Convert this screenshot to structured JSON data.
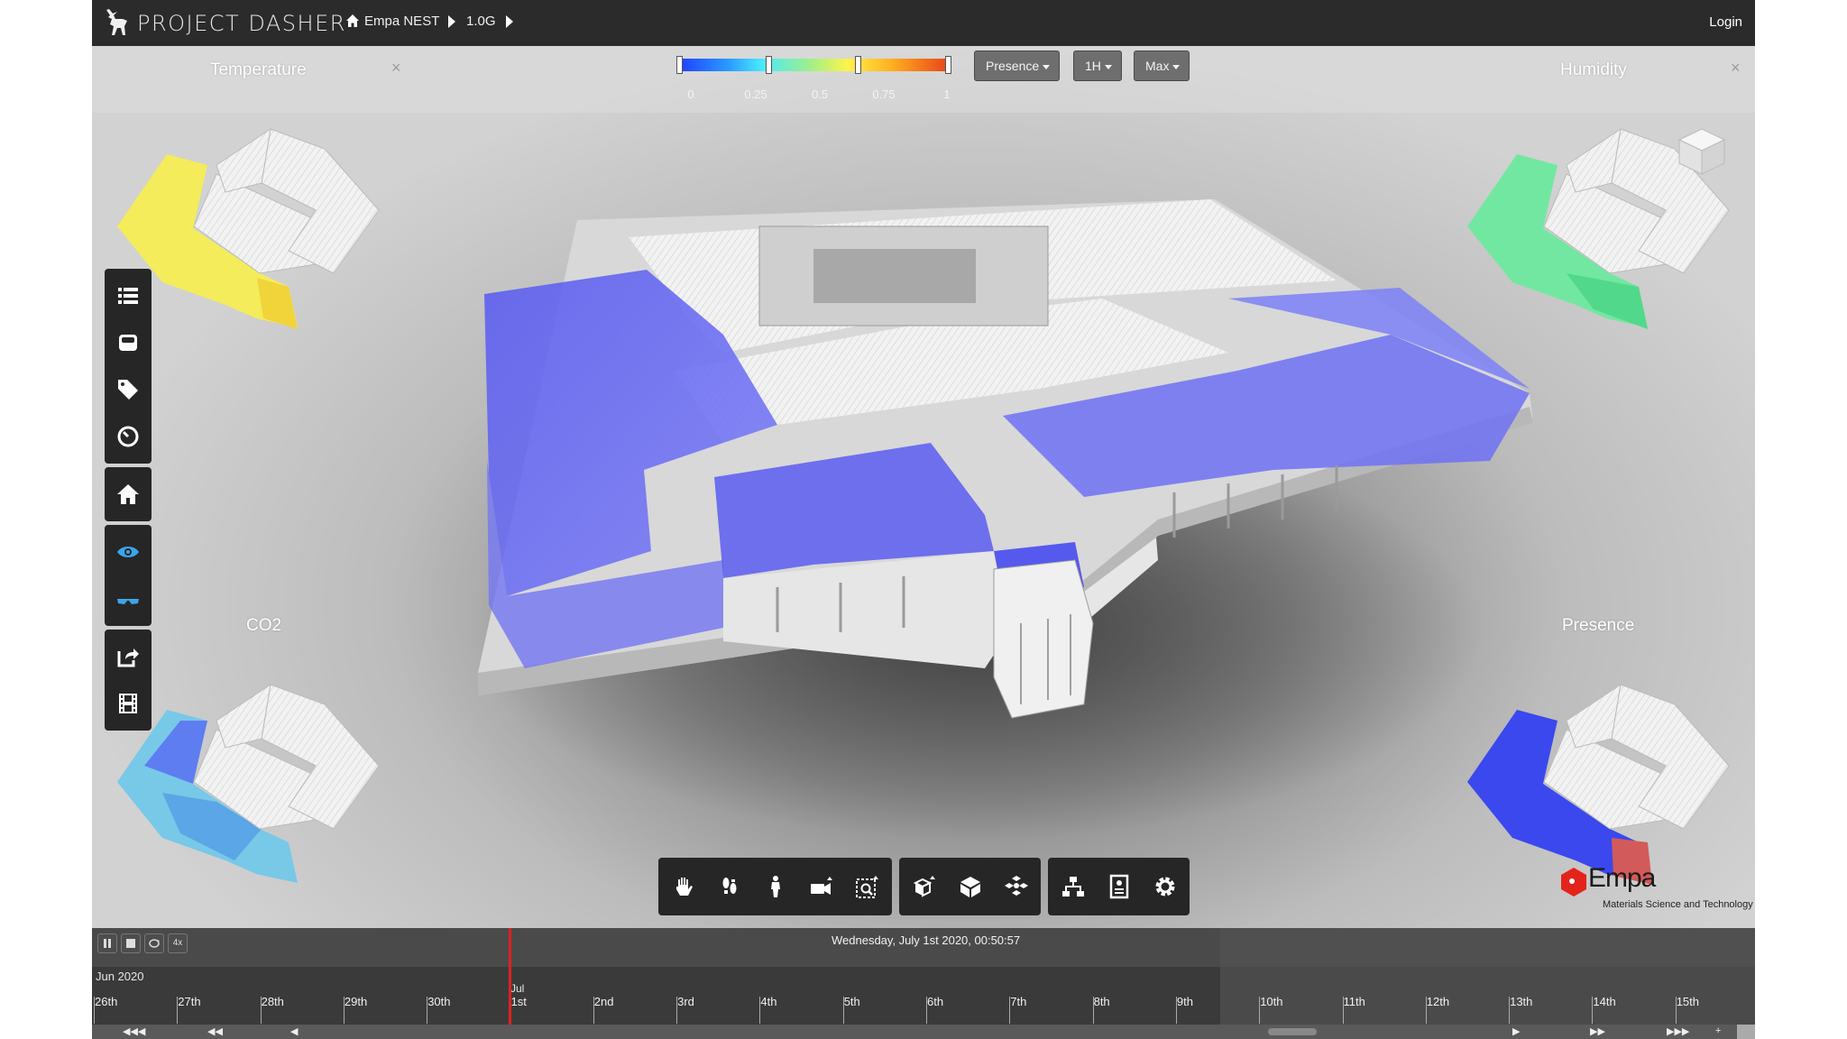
{
  "header": {
    "app_title": "PROJECT DASHER",
    "breadcrumb": [
      "Empa NEST",
      "1.0G"
    ],
    "login": "Login"
  },
  "controls": {
    "scale_ticks": [
      "0",
      "0.25",
      "0.5",
      "0.75",
      "1"
    ],
    "dropdowns": [
      {
        "label": "Presence",
        "value": "Presence"
      },
      {
        "label": "1H",
        "value": "1H"
      },
      {
        "label": "Max",
        "value": "Max"
      }
    ],
    "scale_colors": [
      "#2040ff",
      "#48e8ff",
      "#9ef08a",
      "#fff34a",
      "#ffb020",
      "#e84018"
    ]
  },
  "panels": {
    "temperature": "Temperature",
    "humidity": "Humidity",
    "co2": "CO2",
    "presence": "Presence",
    "close": "×"
  },
  "left_toolbar": [
    {
      "icon": "list-icon"
    },
    {
      "icon": "sensor-icon"
    },
    {
      "icon": "tag-icon"
    },
    {
      "icon": "gauge-icon"
    },
    {
      "icon": "home-icon"
    },
    {
      "icon": "eye-icon"
    },
    {
      "icon": "glasses-icon"
    },
    {
      "icon": "share-icon"
    },
    {
      "icon": "film-icon"
    }
  ],
  "nav_toolbar": [
    {
      "icon": "pan-icon"
    },
    {
      "icon": "walk-icon"
    },
    {
      "icon": "person-icon"
    },
    {
      "icon": "camera-icon"
    },
    {
      "icon": "zoom-window-icon"
    },
    {
      "icon": "explode-icon"
    },
    {
      "icon": "cube-icon"
    },
    {
      "icon": "model-icon"
    },
    {
      "icon": "hierarchy-icon"
    },
    {
      "icon": "properties-icon"
    },
    {
      "icon": "settings-icon"
    }
  ],
  "brand": {
    "name": "Empa",
    "subtitle": "Materials Science and Technology",
    "color": "#e3241b"
  },
  "timeline": {
    "current": "Wednesday, July 1st 2020, 00:50:57",
    "month": "Jun 2020",
    "month2": "Jul",
    "speed": "4x",
    "days": [
      "26th",
      "27th",
      "28th",
      "29th",
      "30th",
      "1st",
      "2nd",
      "3rd",
      "4th",
      "5th",
      "6th",
      "7th",
      "8th",
      "9th",
      "10th",
      "11th",
      "12th",
      "13th",
      "14th",
      "15th"
    ]
  }
}
